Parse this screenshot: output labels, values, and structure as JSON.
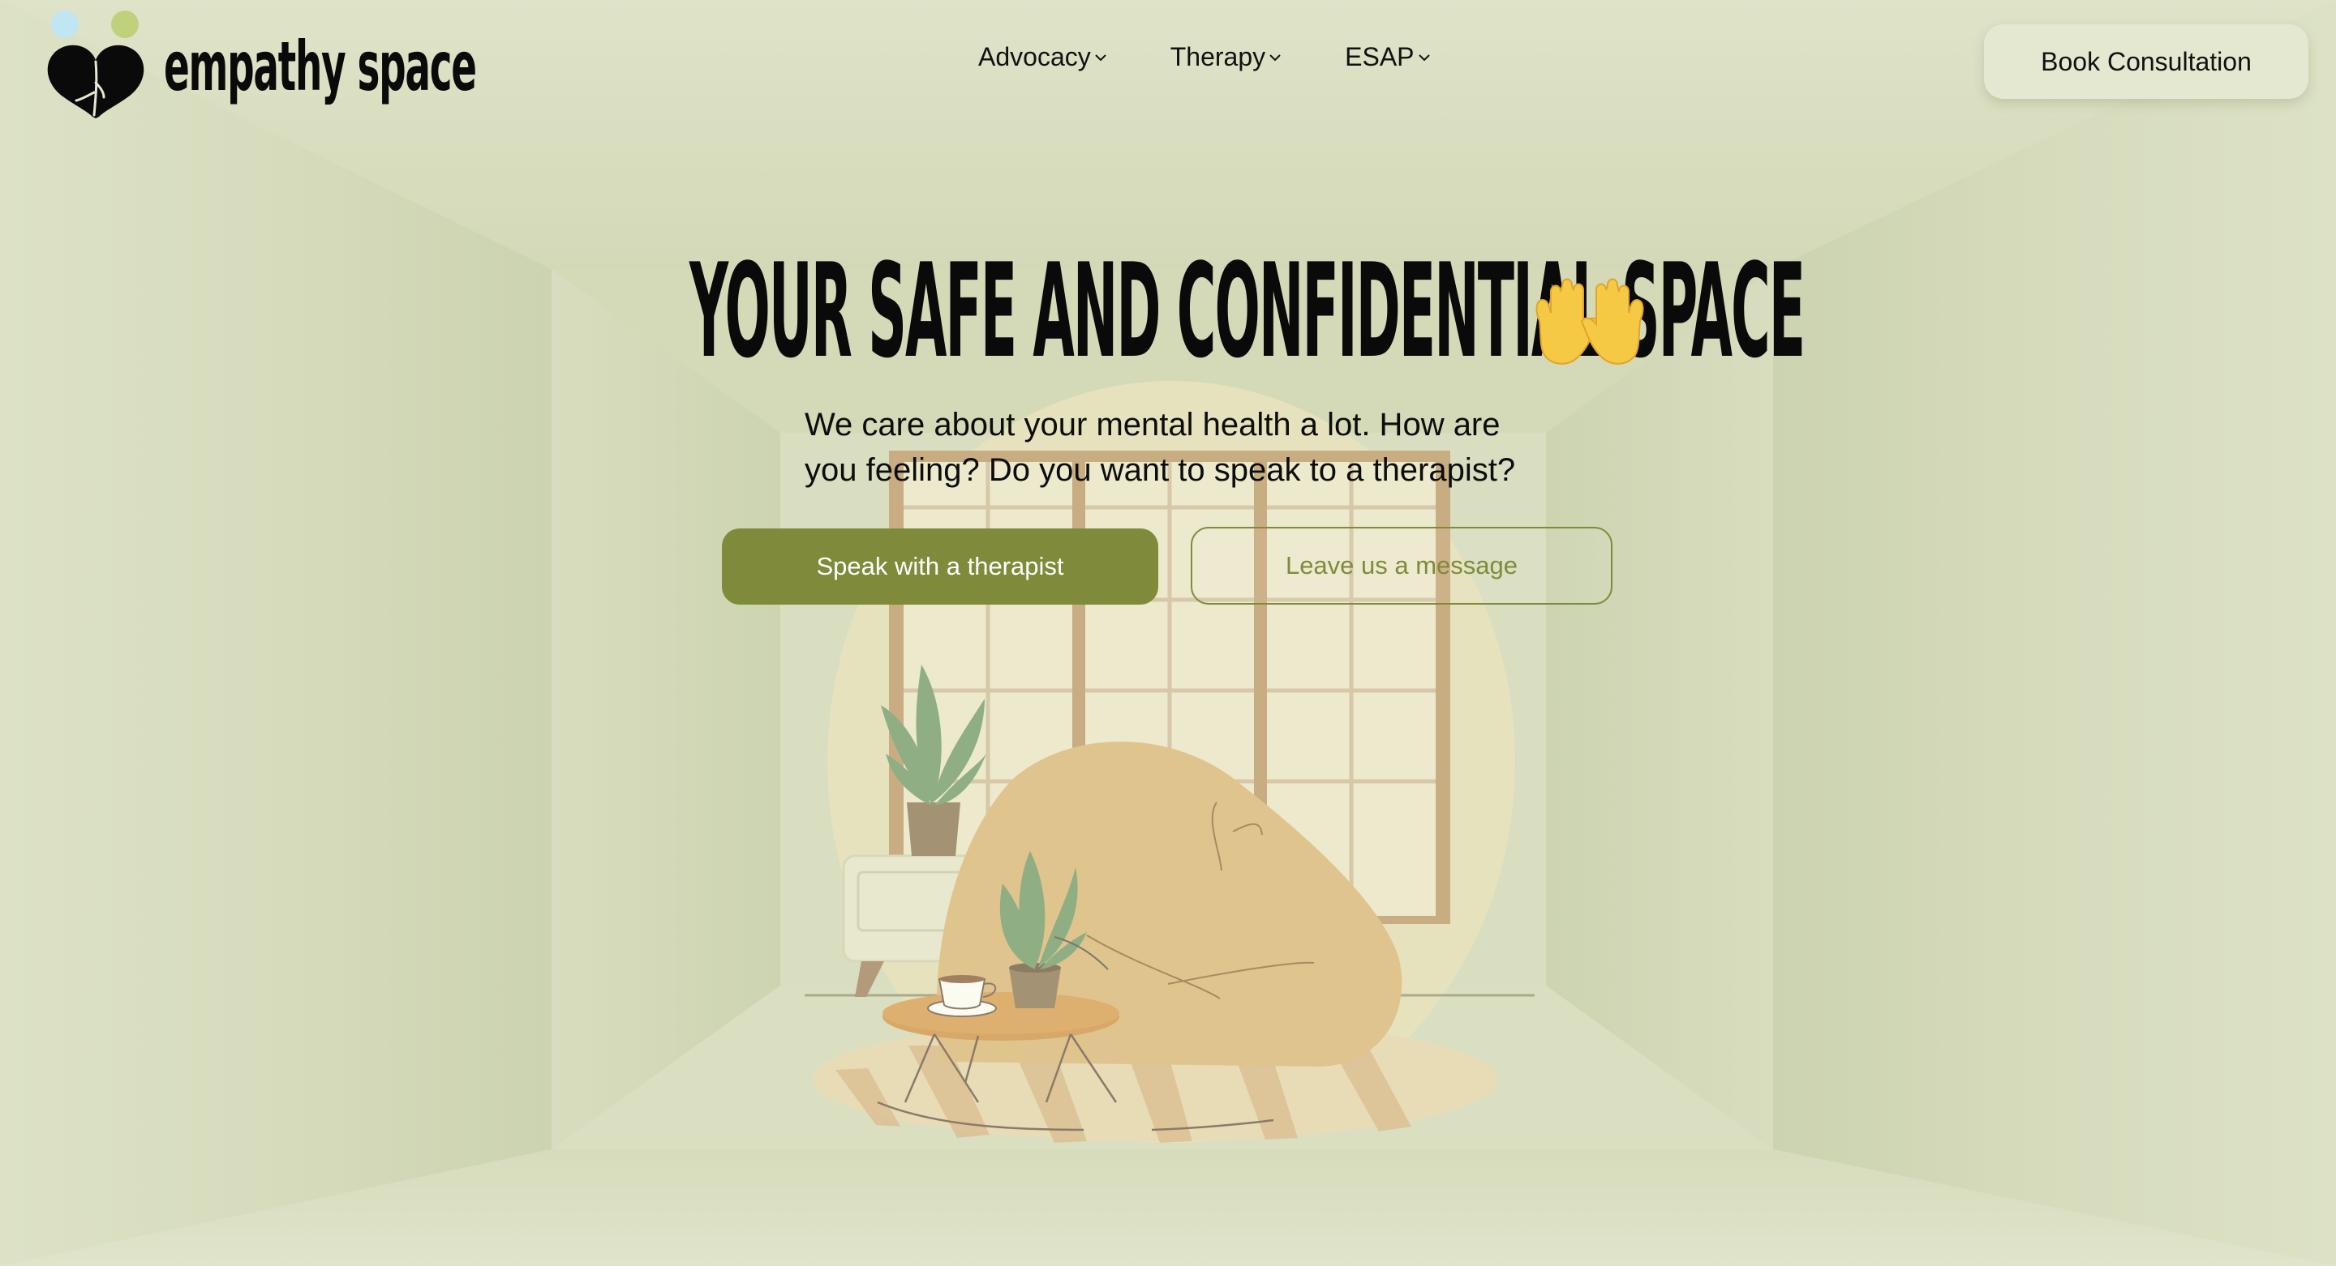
{
  "brand": {
    "name": "empathy space",
    "logo_icon": "heart-logo-icon"
  },
  "nav": {
    "items": [
      {
        "label": "Advocacy",
        "icon": "chevron-down-icon"
      },
      {
        "label": "Therapy",
        "icon": "chevron-down-icon"
      },
      {
        "label": "ESAP",
        "icon": "chevron-down-icon"
      }
    ],
    "cta_label": "Book Consultation"
  },
  "hero": {
    "title": "YOUR SAFE AND CONFIDENTIAL SPACE",
    "title_emoji": "raised-hands-icon",
    "subtitle_line1": "We care about your mental health a lot. How are",
    "subtitle_line2": "you feeling? Do you want to speak to a therapist?",
    "primary_button": "Speak with a therapist",
    "secondary_button": "Leave us a message"
  },
  "colors": {
    "background": "#dfe3c8",
    "accent": "#7f8b3a",
    "beanbag": "#e0c48d",
    "plant": "#8fae83"
  }
}
